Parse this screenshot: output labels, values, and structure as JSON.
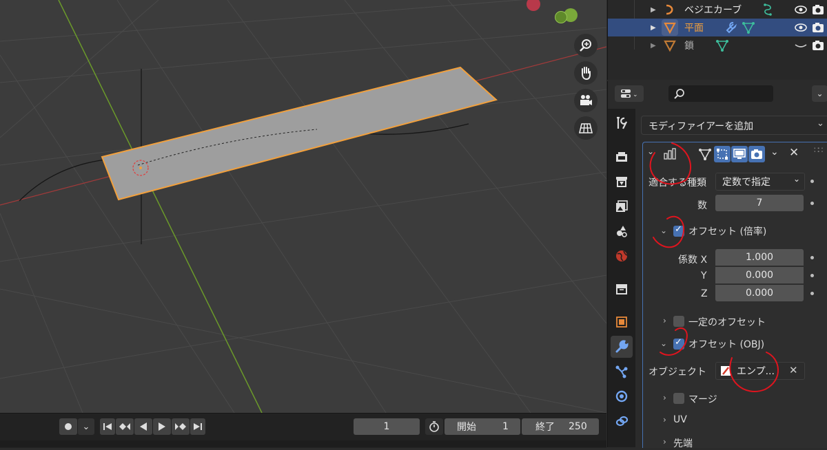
{
  "outliner": {
    "rows": [
      {
        "label": "ベジエカーブ",
        "selected": false
      },
      {
        "label": "平面",
        "selected": true
      },
      {
        "label": "鎖",
        "selected": false
      }
    ]
  },
  "properties": {
    "search_placeholder": "",
    "add_modifier": "モディファイアーを追加",
    "fit_type_label": "適合する種類",
    "fit_type_value": "定数で指定",
    "count_label": "数",
    "count_value": "7",
    "relative_offset_label": "オフセット (倍率)",
    "factor_x_label": "係数 X",
    "factor_x_value": "1.000",
    "factor_y_label": "Y",
    "factor_y_value": "0.000",
    "factor_z_label": "Z",
    "factor_z_value": "0.000",
    "constant_offset_label": "一定のオフセット",
    "object_offset_label": "オフセット (OBJ)",
    "object_label": "オブジェクト",
    "object_value": "エンプ...",
    "merge_label": "マージ",
    "uv_label": "UV",
    "caps_label": "先端"
  },
  "timeline": {
    "current_frame": "1",
    "start_label": "開始",
    "start_value": "1",
    "end_label": "終了",
    "end_value": "250"
  },
  "colors": {
    "selection_outline": "#f2a03c",
    "accent_blue": "#4772b3",
    "x_axis": "#a33a3a",
    "y_axis": "#6b9a2a",
    "annotation_red": "#e0141e"
  }
}
